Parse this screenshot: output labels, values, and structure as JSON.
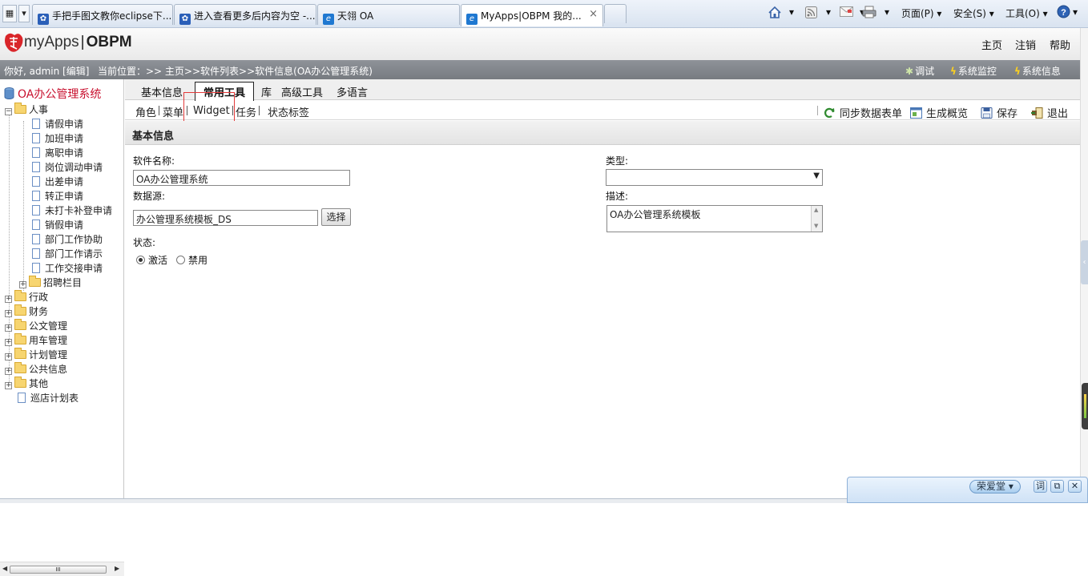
{
  "browser": {
    "tabs": [
      {
        "title": "手把手图文教你eclipse下...",
        "icon": "paw-icon"
      },
      {
        "title": "进入查看更多后内容为空 -...",
        "icon": "paw-icon"
      },
      {
        "title": "天翎 OA",
        "icon": "ie-icon"
      },
      {
        "title": "MyApps|OBPM 我的...",
        "icon": "ie-icon",
        "active": true
      }
    ],
    "close_glyph": "×",
    "commands": {
      "page": "页面(P)",
      "safety": "安全(S)",
      "tools": "工具(O)"
    }
  },
  "app": {
    "logo_light": "myApps",
    "logo_bold": "OBPM",
    "links": {
      "home": "主页",
      "logout": "注销",
      "help": "帮助"
    }
  },
  "infobar": {
    "greeting": "你好, admin [编辑]",
    "location": "当前位置：>> 主页>>软件列表>>软件信息(OA办公管理系统)",
    "debug": "调试",
    "monitor": "系统监控",
    "sysinfo": "系统信息"
  },
  "tree": {
    "root": "OA办公管理系统",
    "hr": "人事",
    "hr_items": [
      "请假申请",
      "加班申请",
      "离职申请",
      "岗位调动申请",
      "出差申请",
      "转正申请",
      "未打卡补登申请",
      "销假申请",
      "部门工作协助",
      "部门工作请示",
      "工作交接申请"
    ],
    "hr_folder": "招聘栏目",
    "groups": [
      "行政",
      "财务",
      "公文管理",
      "用车管理",
      "计划管理",
      "公共信息",
      "其他"
    ],
    "tail": "巡店计划表",
    "scroll_mark": "III"
  },
  "tabs": {
    "basic": "基本信息",
    "common": "常用工具",
    "lib": "库",
    "advanced": "高级工具",
    "lang": "多语言"
  },
  "subtabs": {
    "role": "角色",
    "menu": "菜单",
    "widget": "Widget",
    "task": "任务",
    "status": "状态标签"
  },
  "toolbar": {
    "sync": "同步数据表单",
    "overview": "生成概览",
    "save": "保存",
    "exit": "退出"
  },
  "form": {
    "section": "基本信息",
    "name_label": "软件名称:",
    "name_value": "OA办公管理系统",
    "type_label": "类型:",
    "type_value": "",
    "source_label": "数据源:",
    "source_value": "办公管理系统模板_DS",
    "choose": "选择",
    "desc_label": "描述:",
    "desc_value": "OA办公管理系统模板",
    "status_label": "状态:",
    "active": "激活",
    "disabled": "禁用",
    "status_selected": "激活"
  },
  "dict": {
    "name": "荣爱堂",
    "word": "词"
  }
}
